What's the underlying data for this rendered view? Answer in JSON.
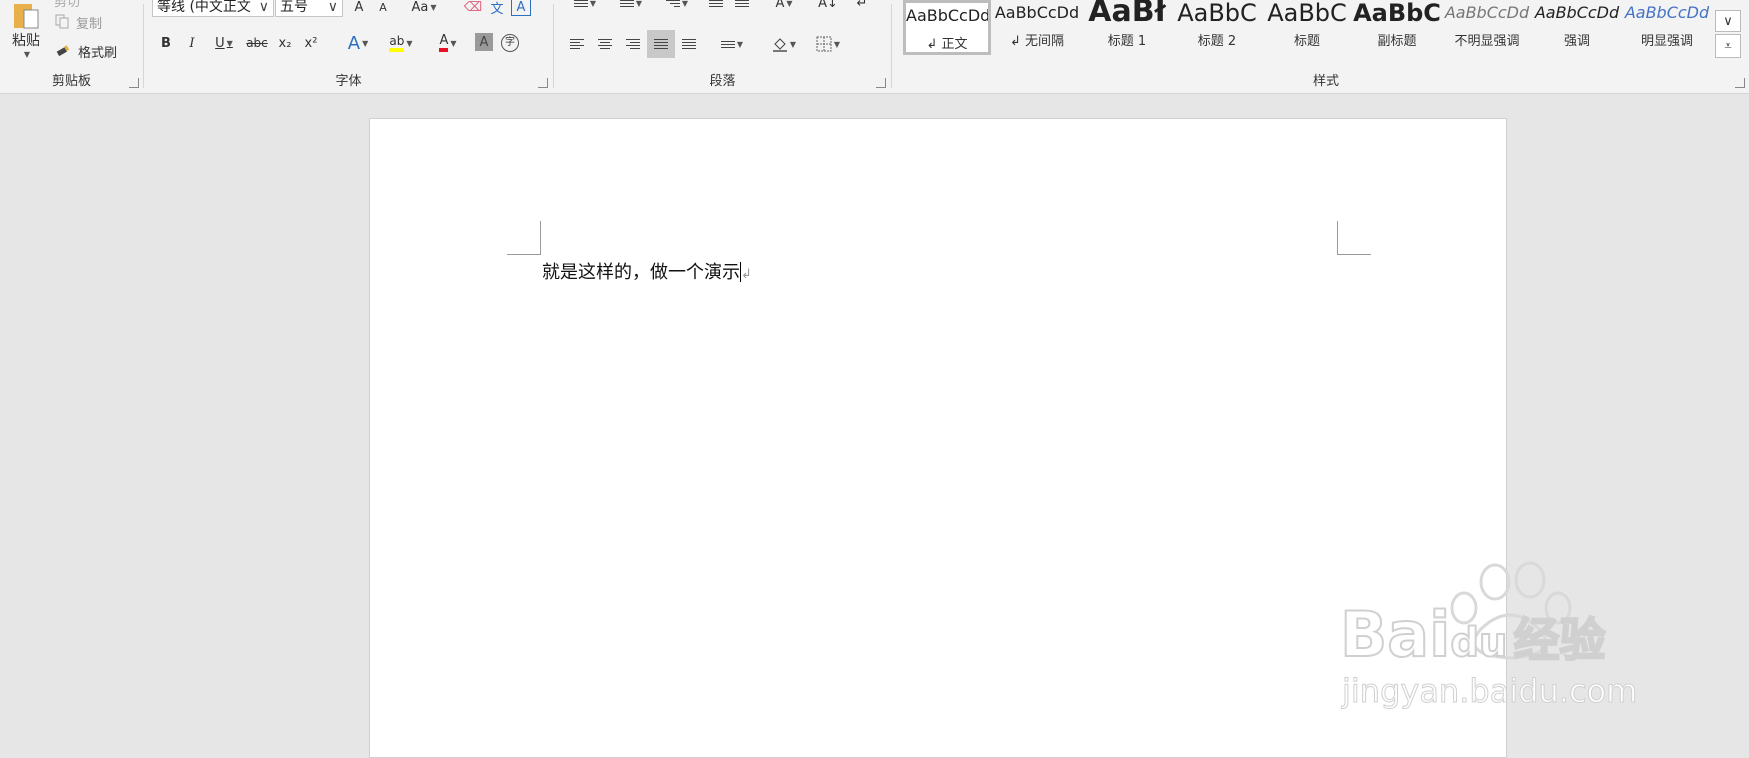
{
  "clipboard": {
    "paste_label": "粘贴",
    "cut_label": "剪切",
    "copy_label": "复制",
    "format_painter_label": "格式刷",
    "group_label": "剪贴板"
  },
  "font": {
    "font_name": "等线 (中文正文",
    "font_size": "五号",
    "grow_label": "A",
    "shrink_label": "A",
    "case_label": "Aa",
    "clear_label": "⌫",
    "phonetic_label": "文",
    "border_char_label": "A",
    "bold_label": "B",
    "italic_label": "I",
    "underline_label": "U",
    "strike_label": "abc",
    "subscript_label": "x₂",
    "superscript_label": "x²",
    "text_effect_label": "A",
    "highlight_label": "ab",
    "font_color_label": "A",
    "char_shading_label": "A",
    "enclose_label": "字",
    "group_label": "字体",
    "highlight_color": "#ffff00",
    "font_color": "#e81123"
  },
  "paragraph": {
    "group_label": "段落",
    "sort_label": "A↓",
    "show_marks_label": "↵"
  },
  "styles": {
    "group_label": "样式",
    "items": [
      {
        "preview": "AaBbCcDd",
        "name": "↲ 正文"
      },
      {
        "preview": "AaBbCcDd",
        "name": "↲ 无间隔"
      },
      {
        "preview": "AaBł",
        "name": "标题 1"
      },
      {
        "preview": "AaBbC",
        "name": "标题 2"
      },
      {
        "preview": "AaBbC",
        "name": "标题"
      },
      {
        "preview": "AaBbC",
        "name": "副标题"
      },
      {
        "preview": "AaBbCcDd",
        "name": "不明显强调"
      },
      {
        "preview": "AaBbCcDd",
        "name": "强调"
      },
      {
        "preview": "AaBbCcDd",
        "name": "明显强调"
      }
    ],
    "accent_color": "#4472c4"
  },
  "document": {
    "text": "就是这样的，做一个演示",
    "paragraph_mark": "↲"
  },
  "watermark": {
    "brand": "Bai",
    "brand_tail": "du",
    "suffix": "经验",
    "url": "jingyan.baidu.com"
  }
}
